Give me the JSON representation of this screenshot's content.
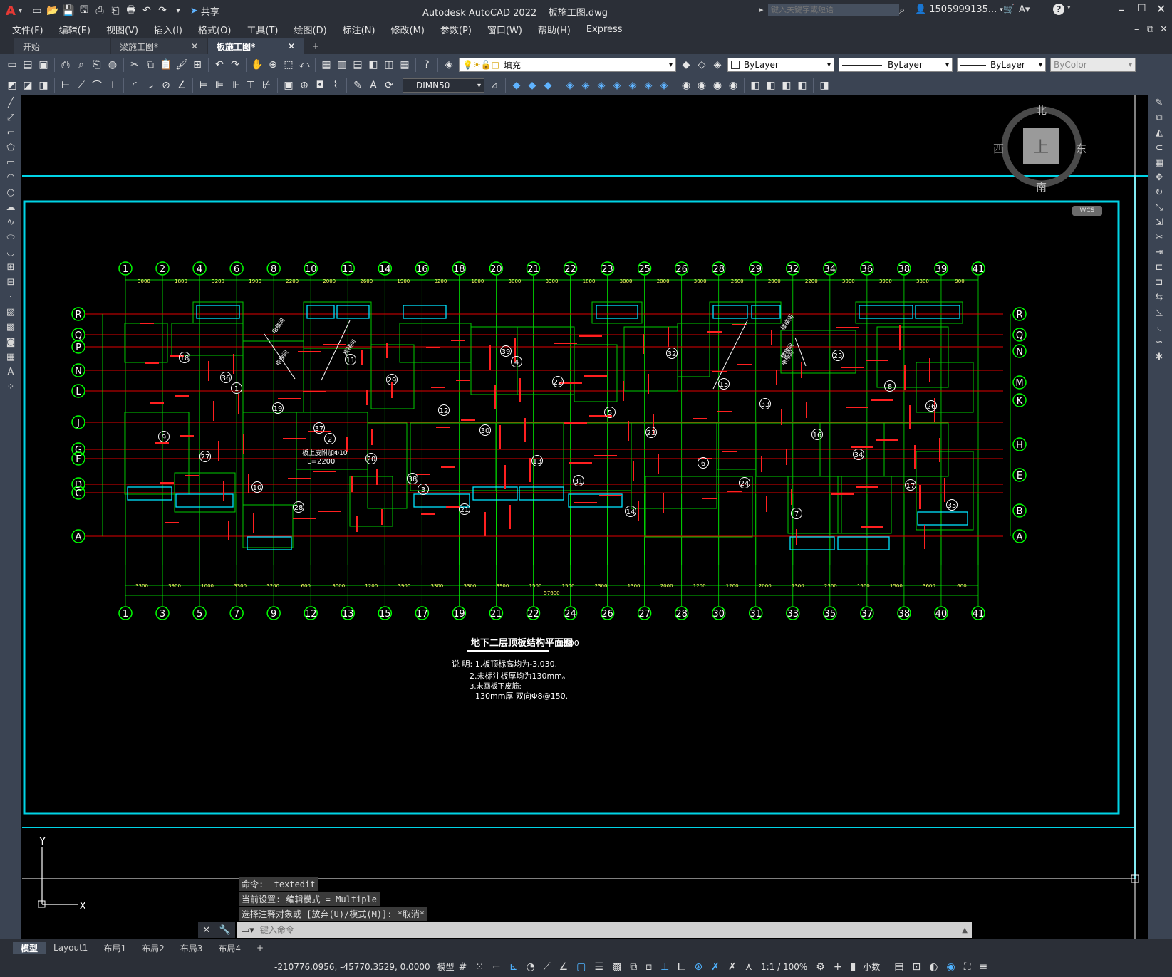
{
  "app": {
    "title": "Autodesk AutoCAD 2022",
    "filename": "板施工图.dwg",
    "share_label": "共享",
    "search_placeholder": "键入关键字或短语",
    "user": "1505999135..."
  },
  "menu": [
    "文件(F)",
    "编辑(E)",
    "视图(V)",
    "插入(I)",
    "格式(O)",
    "工具(T)",
    "绘图(D)",
    "标注(N)",
    "修改(M)",
    "参数(P)",
    "窗口(W)",
    "帮助(H)",
    "Express"
  ],
  "tabs": [
    {
      "label": "开始"
    },
    {
      "label": "梁施工图*"
    },
    {
      "label": "板施工图*"
    }
  ],
  "toolbar": {
    "layer_value": "填充",
    "color_value": "ByLayer",
    "linetype_value": "ByLayer",
    "lineweight_value": "ByLayer",
    "plotstyle_value": "ByColor",
    "dimstyle_value": "DIMN50"
  },
  "viewcube": {
    "north": "北",
    "south": "南",
    "east": "东",
    "west": "西",
    "top": "上",
    "wcs": "WCS"
  },
  "drawing": {
    "title": "地下二层顶板结构平面图",
    "scale": "1:100",
    "notes": [
      "说 明: 1.板顶标高均为-3.030.",
      "2.未标注板厚均为130mm。",
      "3.未画板下皮筋:",
      "130mm厚 双向Φ8@150."
    ],
    "total_dim": "57600",
    "top_axes": [
      "1",
      "2",
      "4",
      "6",
      "8",
      "10",
      "11",
      "14",
      "16",
      "18",
      "20",
      "21",
      "22",
      "23",
      "25",
      "26",
      "28",
      "29",
      "32",
      "34",
      "36",
      "38",
      "39",
      "41"
    ],
    "bottom_axes": [
      "1",
      "3",
      "5",
      "7",
      "9",
      "12",
      "13",
      "15",
      "17",
      "19",
      "21",
      "22",
      "24",
      "26",
      "27",
      "28",
      "30",
      "31",
      "33",
      "35",
      "37",
      "38",
      "40",
      "41"
    ],
    "left_axes": [
      "R",
      "Q",
      "P",
      "N",
      "L",
      "J",
      "G",
      "F",
      "D",
      "C",
      "A"
    ],
    "right_axes": [
      "R",
      "Q",
      "N",
      "M",
      "K",
      "H",
      "E",
      "B",
      "A"
    ],
    "top_dims": [
      "3000",
      "1800",
      "3200",
      "1900",
      "2200",
      "2000",
      "2600",
      "1900",
      "3200",
      "1800",
      "3000",
      "3300",
      "1800",
      "3000",
      "2000",
      "3000",
      "2600",
      "2000",
      "2200",
      "3000",
      "3900",
      "3300",
      "900"
    ],
    "bottom_dims": [
      "3300",
      "3900",
      "1000",
      "3300",
      "3200",
      "600",
      "3000",
      "1200",
      "3900",
      "3300",
      "3300",
      "3900",
      "1500",
      "1500",
      "2300",
      "1300",
      "2000",
      "1200",
      "1200",
      "2000",
      "1300",
      "2300",
      "1500",
      "1500",
      "3600",
      "600"
    ],
    "annotation_text": [
      "板上皮附加Φ10",
      "L=2200"
    ],
    "stair_labels": [
      "电梯间",
      "楼梯间",
      "楼梯间",
      "楼梯间",
      "电梯间",
      "电梯间"
    ]
  },
  "command": {
    "history": [
      "命令: _textedit",
      "当前设置: 编辑模式 = Multiple",
      "选择注释对象或 [放弃(U)/模式(M)]: *取消*"
    ],
    "placeholder": "键入命令"
  },
  "layout_tabs": [
    "模型",
    "Layout1",
    "布局1",
    "布局2",
    "布局3",
    "布局4"
  ],
  "status": {
    "coords": "-210776.0956, -45770.3529, 0.0000",
    "model": "模型",
    "scale": "1:1 / 100%",
    "units": "小数"
  }
}
